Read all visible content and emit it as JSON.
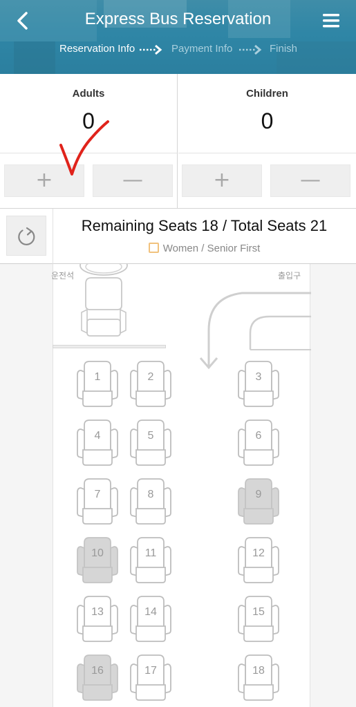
{
  "header": {
    "title": "Express Bus Reservation",
    "steps": [
      {
        "label": "Reservation Info",
        "active": true
      },
      {
        "label": "Payment Info",
        "active": false
      },
      {
        "label": "Finish",
        "active": false
      }
    ],
    "back_icon": "chevron-left-icon",
    "menu_icon": "hamburger-menu-icon",
    "color": "#2f86a6"
  },
  "passengers": {
    "adults": {
      "label": "Adults",
      "count": "0",
      "plus": "+",
      "minus": "—"
    },
    "children": {
      "label": "Children",
      "count": "0",
      "plus": "+",
      "minus": "—"
    }
  },
  "seat_info": {
    "remaining_text": "Remaining Seats 18 / Total Seats 21",
    "legend_label": "Women / Senior First",
    "legend_color": "#f1c27d",
    "refresh_icon": "refresh-icon"
  },
  "seatmap": {
    "driver_label": "운전석",
    "entrance_label": "출입구",
    "seats": [
      {
        "number": "1",
        "taken": false
      },
      {
        "number": "2",
        "taken": false
      },
      {
        "number": "3",
        "taken": false
      },
      {
        "number": "4",
        "taken": false
      },
      {
        "number": "5",
        "taken": false
      },
      {
        "number": "6",
        "taken": false
      },
      {
        "number": "7",
        "taken": false
      },
      {
        "number": "8",
        "taken": false
      },
      {
        "number": "9",
        "taken": true
      },
      {
        "number": "10",
        "taken": true
      },
      {
        "number": "11",
        "taken": false
      },
      {
        "number": "12",
        "taken": false
      },
      {
        "number": "13",
        "taken": false
      },
      {
        "number": "14",
        "taken": false
      },
      {
        "number": "15",
        "taken": false
      },
      {
        "number": "16",
        "taken": true
      },
      {
        "number": "17",
        "taken": false
      },
      {
        "number": "18",
        "taken": false
      }
    ]
  },
  "annotation": {
    "color": "#e0231b"
  }
}
